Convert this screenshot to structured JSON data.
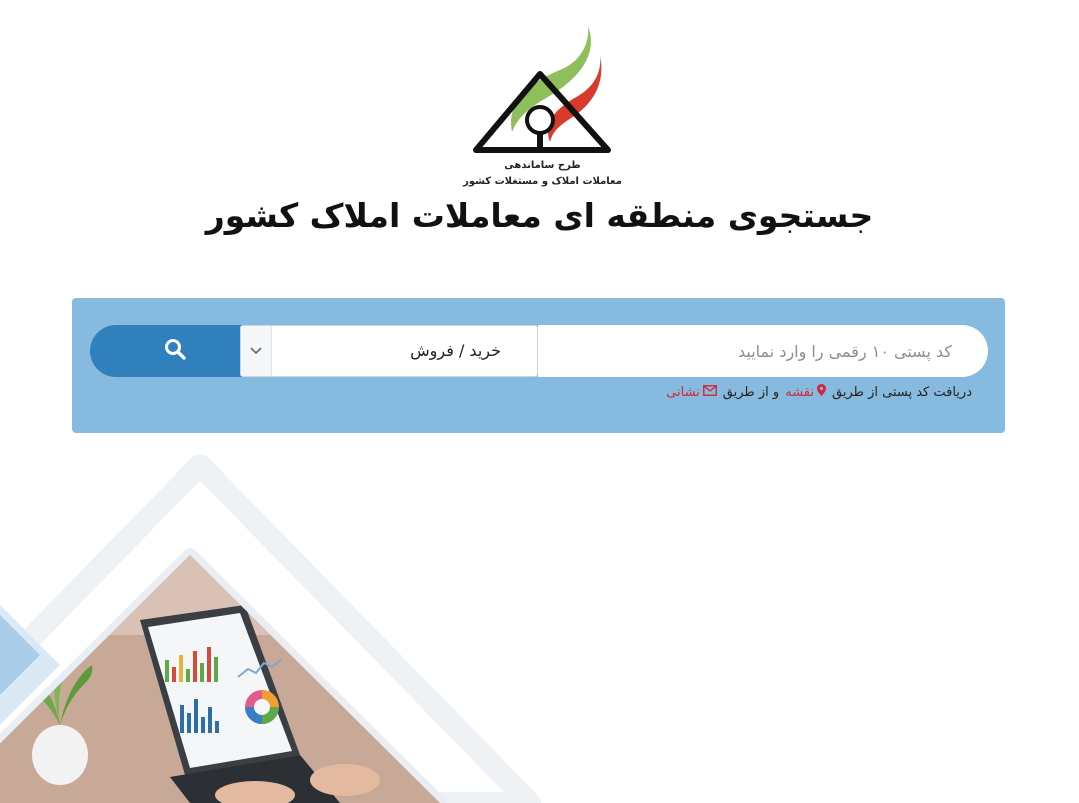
{
  "logo": {
    "line1": "طرح ساماندهی",
    "line2": "معاملات املاک و مستغلات کشور"
  },
  "page_title": "جستجوی منطقه ای معاملات املاک کشور",
  "search": {
    "postal_placeholder": "کد پستی ۱۰ رقمی را وارد نمایید",
    "postal_value": "",
    "transaction_type": "خرید / فروش",
    "button_icon": "search-icon"
  },
  "help": {
    "prefix": "دریافت کد پستی از طریق",
    "map_link": "نقشه",
    "middle": "و از طریق",
    "address_link": "نشانی"
  },
  "colors": {
    "panel": "#86bbdf",
    "button": "#2f80bd",
    "link": "#d2283a"
  }
}
